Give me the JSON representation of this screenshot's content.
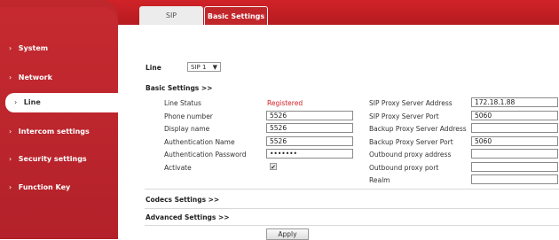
{
  "tabs": [
    {
      "label": "SIP"
    },
    {
      "label": "Basic Settings"
    }
  ],
  "sidebar": {
    "items": [
      {
        "label": "System"
      },
      {
        "label": "Network"
      },
      {
        "label": "Line"
      },
      {
        "label": "Intercom settings"
      },
      {
        "label": "Security settings"
      },
      {
        "label": "Function Key"
      }
    ],
    "chevron": "›"
  },
  "line": {
    "label": "Line",
    "selected": "SIP 1"
  },
  "basic": {
    "header": "Basic Settings >>",
    "line_status_label": "Line Status",
    "line_status_value": "Registered",
    "phone_number_label": "Phone number",
    "phone_number_value": "5526",
    "display_name_label": "Display name",
    "display_name_value": "5526",
    "auth_name_label": "Authentication Name",
    "auth_name_value": "5526",
    "auth_password_label": "Authentication Password",
    "auth_password_value": "•••••••",
    "activate_label": "Activate",
    "activate_checked": "✔",
    "sip_proxy_addr_label": "SIP Proxy Server Address",
    "sip_proxy_addr_value": "172.18.1.88",
    "sip_proxy_port_label": "SIP Proxy Server Port",
    "sip_proxy_port_value": "5060",
    "backup_proxy_addr_label": "Backup Proxy Server Address",
    "backup_proxy_addr_value": "",
    "backup_proxy_port_label": "Backup Proxy Server Port",
    "backup_proxy_port_value": "5060",
    "outbound_addr_label": "Outbound proxy address",
    "outbound_addr_value": "",
    "outbound_port_label": "Outbound proxy port",
    "outbound_port_value": "",
    "realm_label": "Realm",
    "realm_value": ""
  },
  "codecs_header": "Codecs Settings >>",
  "advanced_header": "Advanced Settings >>",
  "apply_label": "Apply",
  "colors": {
    "brand_red": "#c0272d",
    "status_red": "#d21f26"
  }
}
